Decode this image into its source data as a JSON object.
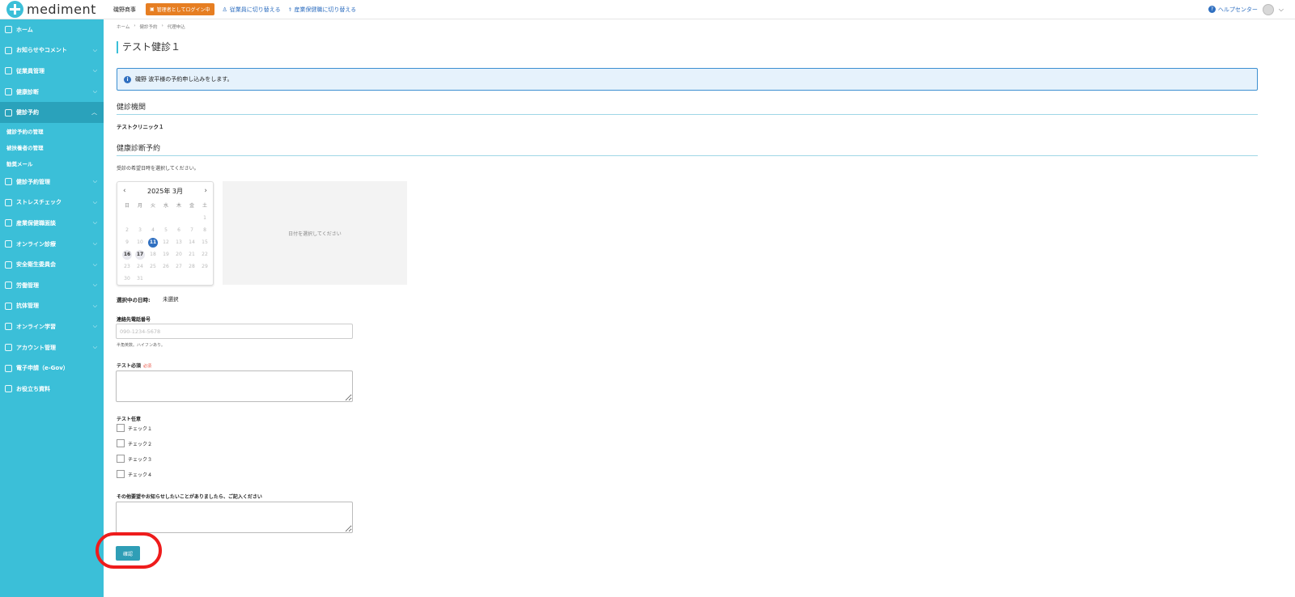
{
  "header": {
    "logo_text": "mediment",
    "company": "磯野商事",
    "login_badge": "管理者としてログイン中",
    "switch_employee": "従業員に切り替える",
    "switch_occupational": "産業保健職に切り替える",
    "help": "ヘルプセンター"
  },
  "sidebar": {
    "items": [
      {
        "label": "ホーム",
        "chevron": false
      },
      {
        "label": "お知らせやコメント",
        "chevron": true
      },
      {
        "label": "従業員管理",
        "chevron": true
      },
      {
        "label": "健康診断",
        "chevron": true
      },
      {
        "label": "健診予約",
        "chevron": true,
        "active": true
      },
      {
        "label": "健診予約管理",
        "chevron": true
      },
      {
        "label": "ストレスチェック",
        "chevron": true
      },
      {
        "label": "産業保健職面談",
        "chevron": true
      },
      {
        "label": "オンライン診療",
        "chevron": true
      },
      {
        "label": "安全衛生委員会",
        "chevron": true
      },
      {
        "label": "労働管理",
        "chevron": true
      },
      {
        "label": "抗体管理",
        "chevron": true
      },
      {
        "label": "オンライン学習",
        "chevron": true
      },
      {
        "label": "アカウント管理",
        "chevron": true
      },
      {
        "label": "電子申請（e-Gov）",
        "chevron": false
      },
      {
        "label": "お役立ち資料",
        "chevron": false
      }
    ],
    "sub_items": [
      "健診予約の管理",
      "被扶養者の管理",
      "勧奨メール"
    ]
  },
  "main": {
    "breadcrumb": [
      "ホーム",
      "健診予約",
      "代理申込"
    ],
    "title": "テスト健診１",
    "info_message": "磯野 波平様の予約申し込みをします。",
    "section_clinic": "健診機関",
    "clinic_name": "テストクリニック１",
    "section_reservation": "健康診断予約",
    "hint": "受診の希望日時を選択してください。",
    "slot_placeholder": "日付を選択してください",
    "selected_label": "選択中の日時:",
    "selected_value": "未選択",
    "phone_label": "連絡先電話番号",
    "phone_placeholder": "090-1234-5678",
    "phone_note": "半角英数。ハイフンあり。",
    "test_required_label": "テスト必須",
    "required_tag": "必須",
    "test_optional_label": "テスト任意",
    "checks": [
      "チェック１",
      "チェック２",
      "チェック３",
      "チェック４"
    ],
    "other_label": "その他要望やお知らせしたいことがありましたら、ご記入ください",
    "confirm_button": "確認"
  },
  "calendar": {
    "month_label": "2025年 3月",
    "weekdays": [
      "日",
      "月",
      "火",
      "水",
      "木",
      "金",
      "土"
    ],
    "leading_blanks": 6,
    "days_in_month": 31,
    "selected_day": 11,
    "available_days": [
      16,
      17
    ]
  }
}
